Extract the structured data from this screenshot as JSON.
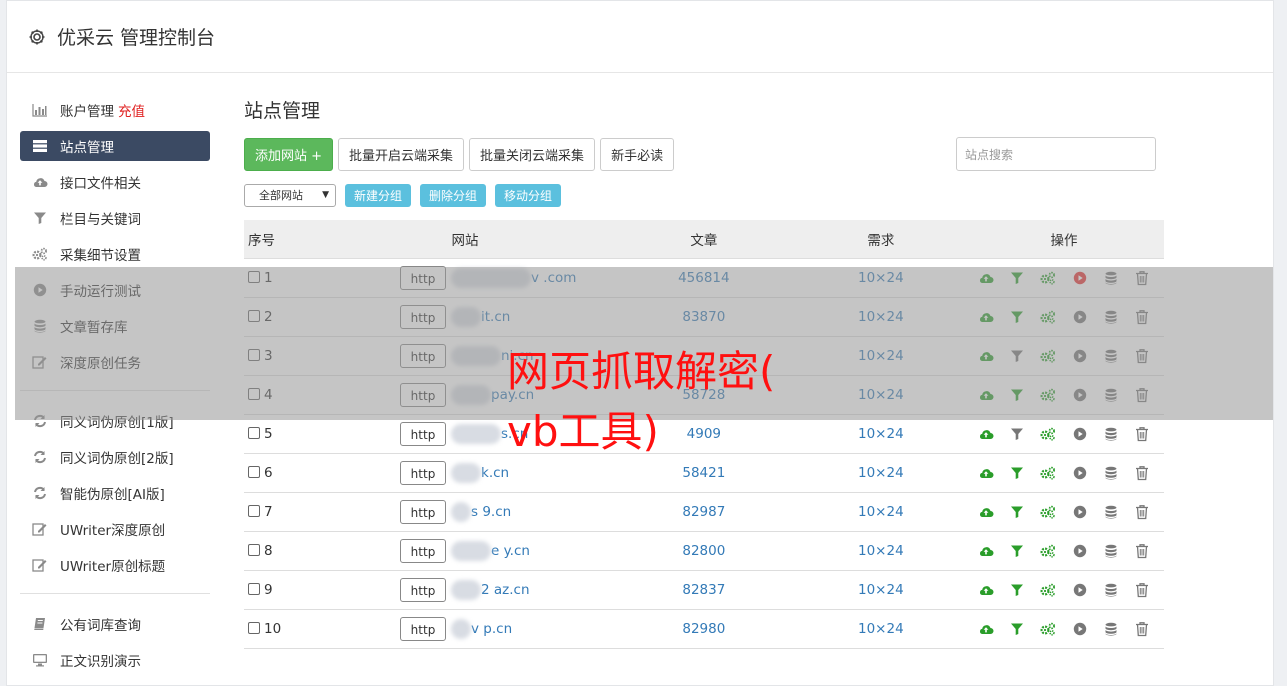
{
  "header": {
    "title": "优采云 管理控制台"
  },
  "sidebar": {
    "items": [
      {
        "label": "账户管理",
        "badge": "充值",
        "icon": "bar-chart-icon",
        "active": false
      },
      {
        "label": "站点管理",
        "icon": "server-icon",
        "active": true
      },
      {
        "label": "接口文件相关",
        "icon": "cloud-upload-icon",
        "active": false
      },
      {
        "label": "栏目与关键词",
        "icon": "filter-icon",
        "active": false
      },
      {
        "label": "采集细节设置",
        "icon": "cogs-icon",
        "active": false
      },
      {
        "label": "手动运行测试",
        "icon": "play-circle-icon",
        "active": false
      },
      {
        "label": "文章暂存库",
        "icon": "database-icon",
        "active": false
      },
      {
        "label": "深度原创任务",
        "icon": "edit-icon",
        "active": false
      }
    ],
    "items2": [
      {
        "label": "同义词伪原创[1版]",
        "icon": "refresh-icon"
      },
      {
        "label": "同义词伪原创[2版]",
        "icon": "refresh-icon"
      },
      {
        "label": "智能伪原创[AI版]",
        "icon": "refresh-icon"
      },
      {
        "label": "UWriter深度原创",
        "icon": "edit-icon"
      },
      {
        "label": "UWriter原创标题",
        "icon": "edit-icon"
      }
    ],
    "items3": [
      {
        "label": "公有词库查询",
        "icon": "book-icon"
      },
      {
        "label": "正文识别演示",
        "icon": "monitor-icon"
      }
    ]
  },
  "main": {
    "title": "站点管理",
    "toolbar": {
      "add_site": "添加网站 +",
      "batch_open": "批量开启云端采集",
      "batch_close": "批量关闭云端采集",
      "guide": "新手必读",
      "search_placeholder": "站点搜索"
    },
    "group": {
      "select_value": "全部网站",
      "new_group": "新建分组",
      "delete_group": "删除分组",
      "move_group": "移动分组"
    },
    "table": {
      "headers": {
        "num": "序号",
        "site": "网站",
        "articles": "文章",
        "demand": "需求",
        "ops": "操作"
      },
      "rows": [
        {
          "num": "1",
          "proto": "http",
          "site": "v .com",
          "articles": "456814",
          "demand": "10×24",
          "filter_active": true,
          "run_active": true
        },
        {
          "num": "2",
          "proto": "http",
          "site": "it.cn",
          "articles": "83870",
          "demand": "10×24",
          "filter_active": true,
          "run_active": false
        },
        {
          "num": "3",
          "proto": "http",
          "site": "ni.cn",
          "articles": "",
          "demand": "10×24",
          "filter_active": false,
          "run_active": false
        },
        {
          "num": "4",
          "proto": "http",
          "site": "pay.cn",
          "articles": "58728",
          "demand": "10×24",
          "filter_active": true,
          "run_active": false
        },
        {
          "num": "5",
          "proto": "http",
          "site": "s.cn",
          "articles": "4909",
          "demand": "10×24",
          "filter_active": false,
          "run_active": false
        },
        {
          "num": "6",
          "proto": "http",
          "site": "k.cn",
          "articles": "58421",
          "demand": "10×24",
          "filter_active": true,
          "run_active": false
        },
        {
          "num": "7",
          "proto": "http",
          "site": "s 9.cn",
          "articles": "82987",
          "demand": "10×24",
          "filter_active": true,
          "run_active": false
        },
        {
          "num": "8",
          "proto": "http",
          "site": "e y.cn",
          "articles": "82800",
          "demand": "10×24",
          "filter_active": true,
          "run_active": false
        },
        {
          "num": "9",
          "proto": "http",
          "site": "2 az.cn",
          "articles": "82837",
          "demand": "10×24",
          "filter_active": true,
          "run_active": false
        },
        {
          "num": "10",
          "proto": "http",
          "site": "v p.cn",
          "articles": "82980",
          "demand": "10×24",
          "filter_active": true,
          "run_active": false
        }
      ]
    }
  },
  "watermark": {
    "line1": "网页抓取解密(",
    "line2": "vb工具)"
  },
  "colors": {
    "green": "#5cb85c",
    "info": "#5bc0de",
    "nav_active": "#3b4a63",
    "link": "#337ab7",
    "red": "#e02020",
    "icon_green": "#2a9d2a",
    "icon_gray": "#777777"
  }
}
